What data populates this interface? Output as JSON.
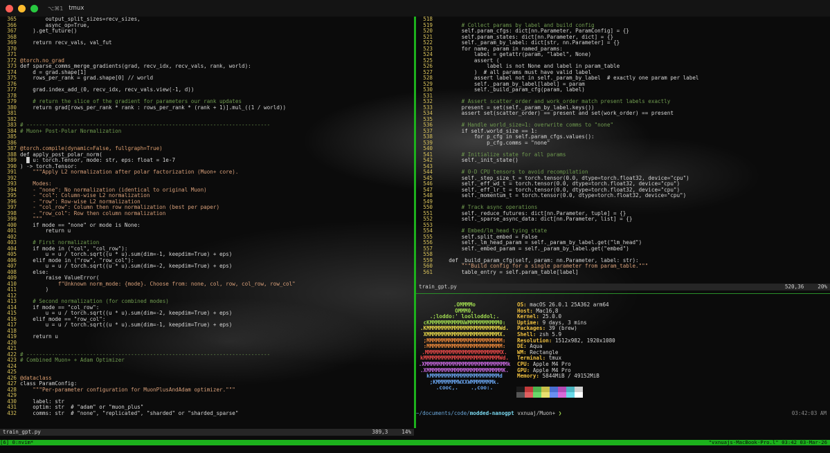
{
  "window": {
    "shortcut": "⌥⌘1",
    "title": "tmux"
  },
  "left_code": [
    [
      "365",
      "        output_split_sizes=recv_sizes,",
      ""
    ],
    [
      "366",
      "        async_op=True,",
      ""
    ],
    [
      "367",
      "    ).get_future()",
      ""
    ],
    [
      "368",
      "",
      ""
    ],
    [
      "369",
      "    return recv_vals, val_fut",
      ""
    ],
    [
      "370",
      "",
      ""
    ],
    [
      "371",
      "",
      ""
    ],
    [
      "372",
      "@torch.no_grad",
      "d"
    ],
    [
      "373",
      "def sparse_comms_merge_gradients(grad, recv_idx, recv_vals, rank, world):",
      ""
    ],
    [
      "374",
      "    d = grad.shape[1]",
      ""
    ],
    [
      "375",
      "    rows_per_rank = grad.shape[0] // world",
      ""
    ],
    [
      "376",
      "",
      ""
    ],
    [
      "377",
      "    grad.index_add_(0, recv_idx, recv_vals.view(-1, d))",
      ""
    ],
    [
      "378",
      "",
      ""
    ],
    [
      "379",
      "    # return the slice of the gradient for parameters our rank updates",
      "c"
    ],
    [
      "380",
      "    return grad[rows_per_rank * rank : rows_per_rank * (rank + 1)].mul_((1 / world))",
      ""
    ],
    [
      "381",
      "",
      ""
    ],
    [
      "382",
      "",
      ""
    ],
    [
      "383",
      "# -----------------------------------------------------------------------------",
      "c"
    ],
    [
      "384",
      "# Muon+ Post-Polar Normalization",
      "c"
    ],
    [
      "385",
      "",
      ""
    ],
    [
      "386",
      "",
      ""
    ],
    [
      "387",
      "@torch.compile(dynamic=False, fullgraph=True)",
      "d"
    ],
    [
      "388",
      "def apply_post_polar_norm(",
      ""
    ],
    [
      "389",
      "  █ u: torch.Tensor, mode: str, eps: float = 1e-7",
      ""
    ],
    [
      "390",
      ") -> torch.Tensor:",
      ""
    ],
    [
      "391",
      "    \"\"\"Apply L2 normalization after polar factorization (Muon+ core).",
      "s"
    ],
    [
      "392",
      "",
      ""
    ],
    [
      "393",
      "    Modes:",
      "s"
    ],
    [
      "394",
      "    - \"none\": No normalization (identical to original Muon)",
      "s"
    ],
    [
      "395",
      "    - \"col\": Column-wise L2 normalization",
      "s"
    ],
    [
      "396",
      "    - \"row\": Row-wise L2 normalization",
      "s"
    ],
    [
      "397",
      "    - \"col_row\": Column then row normalization (best per paper)",
      "s"
    ],
    [
      "398",
      "    - \"row_col\": Row then column normalization",
      "s"
    ],
    [
      "399",
      "    \"\"\"",
      "s"
    ],
    [
      "400",
      "    if mode == \"none\" or mode is None:",
      ""
    ],
    [
      "401",
      "        return u",
      ""
    ],
    [
      "402",
      "",
      ""
    ],
    [
      "403",
      "    # First normalization",
      "c"
    ],
    [
      "404",
      "    if mode in (\"col\", \"col_row\"):",
      ""
    ],
    [
      "405",
      "        u = u / torch.sqrt((u * u).sum(dim=-1, keepdim=True) + eps)",
      ""
    ],
    [
      "406",
      "    elif mode in (\"row\", \"row_col\"):",
      ""
    ],
    [
      "407",
      "        u = u / torch.sqrt((u * u).sum(dim=-2, keepdim=True) + eps)",
      ""
    ],
    [
      "408",
      "    else:",
      ""
    ],
    [
      "409",
      "        raise ValueError(",
      ""
    ],
    [
      "410",
      "            f\"Unknown norm_mode: {mode}. Choose from: none, col, row, col_row, row_col\"",
      "s"
    ],
    [
      "411",
      "        )",
      ""
    ],
    [
      "412",
      "",
      ""
    ],
    [
      "413",
      "    # Second normalization (for combined modes)",
      "c"
    ],
    [
      "414",
      "    if mode == \"col_row\":",
      ""
    ],
    [
      "415",
      "        u = u / torch.sqrt((u * u).sum(dim=-2, keepdim=True) + eps)",
      ""
    ],
    [
      "416",
      "    elif mode == \"row_col\":",
      ""
    ],
    [
      "417",
      "        u = u / torch.sqrt((u * u).sum(dim=-1, keepdim=True) + eps)",
      ""
    ],
    [
      "418",
      "",
      ""
    ],
    [
      "419",
      "    return u",
      ""
    ],
    [
      "420",
      "",
      ""
    ],
    [
      "421",
      "",
      ""
    ],
    [
      "422",
      "# -----------------------------------------------------------------------------",
      "c"
    ],
    [
      "423",
      "# Combined Muon+ + Adam Optimizer",
      "c"
    ],
    [
      "424",
      "",
      ""
    ],
    [
      "425",
      "",
      ""
    ],
    [
      "426",
      "@dataclass",
      "d"
    ],
    [
      "427",
      "class ParamConfig:",
      ""
    ],
    [
      "428",
      "    \"\"\"Per-parameter configuration for MuonPlusAndAdam optimizer.\"\"\"",
      "s"
    ],
    [
      "429",
      "",
      ""
    ],
    [
      "430",
      "    label: str",
      ""
    ],
    [
      "431",
      "    optim: str  # \"adam\" or \"muon_plus\"",
      ""
    ],
    [
      "432",
      "    comms: str  # \"none\", \"replicated\", \"sharded\" or \"sharded_sparse\"",
      ""
    ]
  ],
  "right_code": [
    [
      "518",
      "",
      ""
    ],
    [
      "519",
      "        # Collect params by label and build config",
      "c"
    ],
    [
      "520",
      "        self.param_cfgs: dict[nn.Parameter, ParamConfig] = {}",
      ""
    ],
    [
      "521",
      "        self.param_states: dict[nn.Parameter, dict] = {}",
      ""
    ],
    [
      "522",
      "        self._param_by_label: dict[str, nn.Parameter] = {}",
      ""
    ],
    [
      "523",
      "        for name, param in named_params:",
      ""
    ],
    [
      "524",
      "            label = getattr(param, \"label\", None)",
      ""
    ],
    [
      "525",
      "            assert (",
      ""
    ],
    [
      "526",
      "                label is not None and label in param_table",
      ""
    ],
    [
      "527",
      "            )  # all params must have valid label",
      ""
    ],
    [
      "528",
      "            assert label not in self._param_by_label  # exactly one param per label",
      ""
    ],
    [
      "529",
      "            self._param_by_label[label] = param",
      ""
    ],
    [
      "530",
      "            self._build_param_cfg(param, label)",
      ""
    ],
    [
      "531",
      "",
      ""
    ],
    [
      "532",
      "        # Assert scatter_order and work_order match present labels exactly",
      "c"
    ],
    [
      "533",
      "        present = set(self._param_by_label.keys())",
      ""
    ],
    [
      "534",
      "        assert set(scatter_order) == present and set(work_order) == present",
      ""
    ],
    [
      "535",
      "",
      ""
    ],
    [
      "536",
      "        # Handle world_size=1: overwrite comms to \"none\"",
      "c"
    ],
    [
      "537",
      "        if self.world_size == 1:",
      ""
    ],
    [
      "538",
      "            for p_cfg in self.param_cfgs.values():",
      ""
    ],
    [
      "539",
      "                p_cfg.comms = \"none\"",
      ""
    ],
    [
      "540",
      "",
      ""
    ],
    [
      "541",
      "        # Initialize state for all params",
      "c"
    ],
    [
      "542",
      "        self._init_state()",
      ""
    ],
    [
      "543",
      "",
      ""
    ],
    [
      "544",
      "        # 0-D CPU tensors to avoid recompilation",
      "c"
    ],
    [
      "545",
      "        self._step_size_t = torch.tensor(0.0, dtype=torch.float32, device=\"cpu\")",
      ""
    ],
    [
      "546",
      "        self._eff_wd_t = torch.tensor(0.0, dtype=torch.float32, device=\"cpu\")",
      ""
    ],
    [
      "547",
      "        self._eff_lr_t = torch.tensor(0.0, dtype=torch.float32, device=\"cpu\")",
      ""
    ],
    [
      "548",
      "        self._momentum_t = torch.tensor(0.0, dtype=torch.float32, device=\"cpu\")",
      ""
    ],
    [
      "549",
      "",
      ""
    ],
    [
      "550",
      "        # Track async operations",
      "c"
    ],
    [
      "551",
      "        self._reduce_futures: dict[nn.Parameter, tuple] = {}",
      ""
    ],
    [
      "552",
      "        self._sparse_async_data: dict[nn.Parameter, list] = {}",
      ""
    ],
    [
      "553",
      "",
      ""
    ],
    [
      "554",
      "        # Embed/lm_head tying state",
      "c"
    ],
    [
      "555",
      "        self.split_embed = False",
      ""
    ],
    [
      "556",
      "        self._lm_head_param = self._param_by_label.get(\"lm_head\")",
      ""
    ],
    [
      "557",
      "        self._embed_param = self._param_by_label.get(\"embed\")",
      ""
    ],
    [
      "558",
      "",
      ""
    ],
    [
      "559",
      "    def _build_param_cfg(self, param: nn.Parameter, label: str):",
      ""
    ],
    [
      "560",
      "        \"\"\"Build config for a single parameter from param_table.\"\"\"",
      "s"
    ],
    [
      "561",
      "        table_entry = self.param_table[label]",
      ""
    ]
  ],
  "left_status": {
    "file": "train_gpt.py",
    "pos": "389,3",
    "pct": "14%"
  },
  "right_status": {
    "file": "train_gpt.py",
    "pos": "520,36",
    "pct": "20%"
  },
  "neofetch_art": [
    ".OMMMMo",
    "OMMM0,",
    ".;loddo:' loolloddol;.",
    "cKMMMMMMMMMMNWMMMMMMMMMM0:",
    ".KMMMMMMMMMMMMMMMMMMMMMMMWd.",
    "XMMMMMMMMMMMMMMMMMMMMMMMX.",
    ";MMMMMMMMMMMMMMMMMMMMMMMM:",
    ":MMMMMMMMMMMMMMMMMMMMMMMM:",
    ".MMMMMMMMMMMMMMMMMMMMMMMMX.",
    "kMMMMMMMMMMMMMMMMMMMMMMMMWd.",
    ".XMMMMMMMMMMMMMMMMMMMMMMMMMMk",
    ".XMMMMMMMMMMMMMMMMMMMMMMMMK.",
    "kMMMMMMMMMMMMMMMMMMMMMMd",
    ";KMMMMMMMWXXWMMMMMMMk.",
    ".cooc,.    .,coo:."
  ],
  "neofetch_art_colors": [
    "#9fd94f",
    "#9fd94f",
    "#9fd94f",
    "#9fd94f",
    "#e8d84a",
    "#e8d84a",
    "#f08a3a",
    "#f08a3a",
    "#ea4a4a",
    "#ea4a4a",
    "#c86adf",
    "#c86adf",
    "#6aa6f0",
    "#6aa6f0",
    "#6aa6f0"
  ],
  "neofetch_info": [
    {
      "k": "OS:",
      "v": " macOS 26.0.1 25A362 arm64"
    },
    {
      "k": "Host:",
      "v": " Mac16,8"
    },
    {
      "k": "Kernel:",
      "v": " 25.0.0"
    },
    {
      "k": "Uptime:",
      "v": " 9 days, 3 mins"
    },
    {
      "k": "Packages:",
      "v": " 39 (brew)"
    },
    {
      "k": "Shell:",
      "v": " zsh 5.9"
    },
    {
      "k": "Resolution:",
      "v": " 1512x982, 1920x1080"
    },
    {
      "k": "DE:",
      "v": " Aqua"
    },
    {
      "k": "WM:",
      "v": " Rectangle"
    },
    {
      "k": "Terminal:",
      "v": " tmux"
    },
    {
      "k": "CPU:",
      "v": " Apple M4 Pro"
    },
    {
      "k": "GPU:",
      "v": " Apple M4 Pro"
    },
    {
      "k": "Memory:",
      "v": " 5844MiB / 49152MiB"
    }
  ],
  "swatches": [
    "#1a1a1a",
    "#c23b3b",
    "#4fb34f",
    "#c9c04a",
    "#4a6fd0",
    "#b44ab4",
    "#4ab4c0",
    "#d0d0d0",
    "#555555",
    "#e06060",
    "#6ad86a",
    "#e8e070",
    "#6a8ff0",
    "#d86ad8",
    "#6ad8e8",
    "#ffffff"
  ],
  "prompt": {
    "path": "~/documents/code/",
    "repo": "modded-nanogpt",
    "rest": " vxnuaj/Muon+ ",
    "arrow": "❯",
    "time": "03:42:03 AM"
  },
  "tmux": {
    "left": "[6] 0:nvim*",
    "right": "\"vxnuajs-MacBook-Pro.l\" 03:42 03-Mar-26"
  },
  "colors": {
    "accent": "#1cb11c",
    "linenum": "#d9c25a",
    "comment": "#6f9a4f",
    "keyword": "#6f8fe0",
    "string": "#d9a07a"
  }
}
